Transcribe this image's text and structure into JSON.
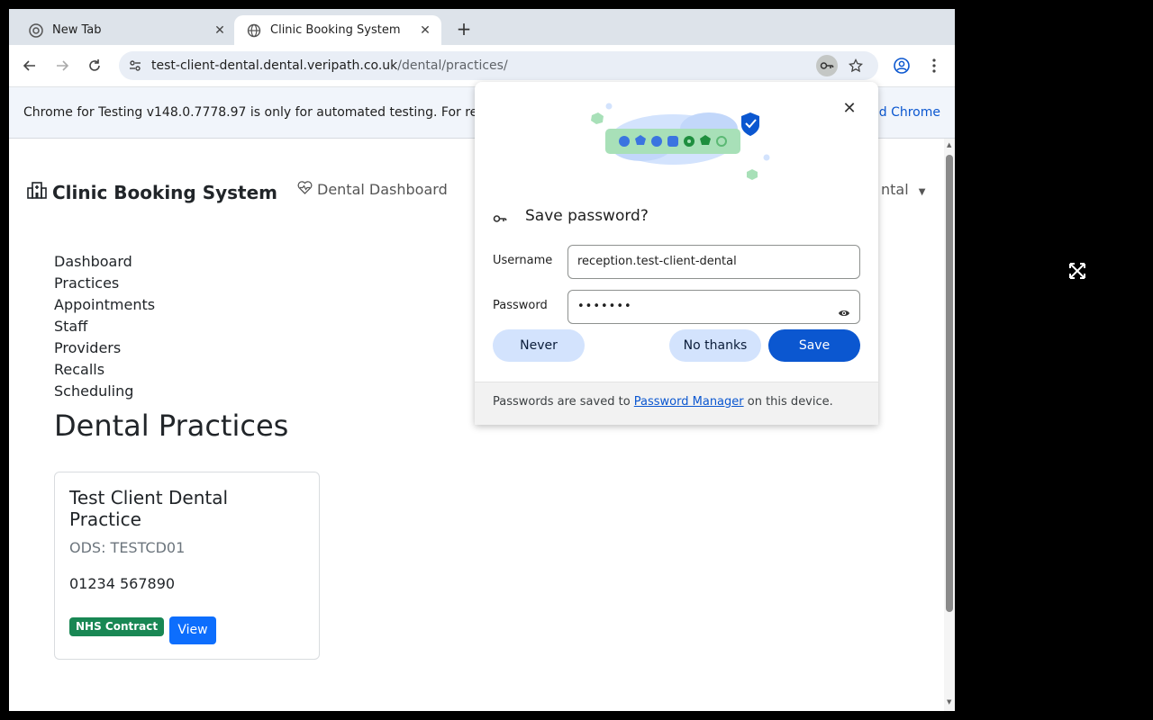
{
  "browser": {
    "tabs": [
      {
        "title": "New Tab",
        "icon": "chrome-icon",
        "active": false
      },
      {
        "title": "Clinic Booking System",
        "icon": "globe-icon",
        "active": true
      }
    ],
    "url_host": "test-client-dental.dental.veripath.co.uk",
    "url_path": "/dental/practices/",
    "infobar_text": "Chrome for Testing v148.0.7778.97 is only for automated testing. For re",
    "infobar_link": "d Chrome"
  },
  "app": {
    "brand": "Clinic Booking System",
    "nav_dashboard": "Dental Dashboard",
    "nav_right": "ntal",
    "menu": [
      "Dashboard",
      "Practices",
      "Appointments",
      "Staff",
      "Providers",
      "Recalls",
      "Scheduling"
    ],
    "page_title": "Dental Practices",
    "practice": {
      "name": "Test Client Dental Practice",
      "ods": "ODS: TESTCD01",
      "phone": "01234 567890",
      "badge": "NHS Contract",
      "view_label": "View"
    }
  },
  "password_popup": {
    "title": "Save password?",
    "username_label": "Username",
    "username_value": "reception.test-client-dental",
    "password_label": "Password",
    "password_value": "•••••••",
    "never_label": "Never",
    "no_thanks_label": "No thanks",
    "save_label": "Save",
    "footer_pre": "Passwords are saved to ",
    "footer_link": "Password Manager",
    "footer_post": " on this device."
  },
  "colors": {
    "primary": "#0d6efd",
    "badge_green": "#198754",
    "chrome_blue": "#0b57d0",
    "tonal_blue": "#d3e3fd"
  }
}
